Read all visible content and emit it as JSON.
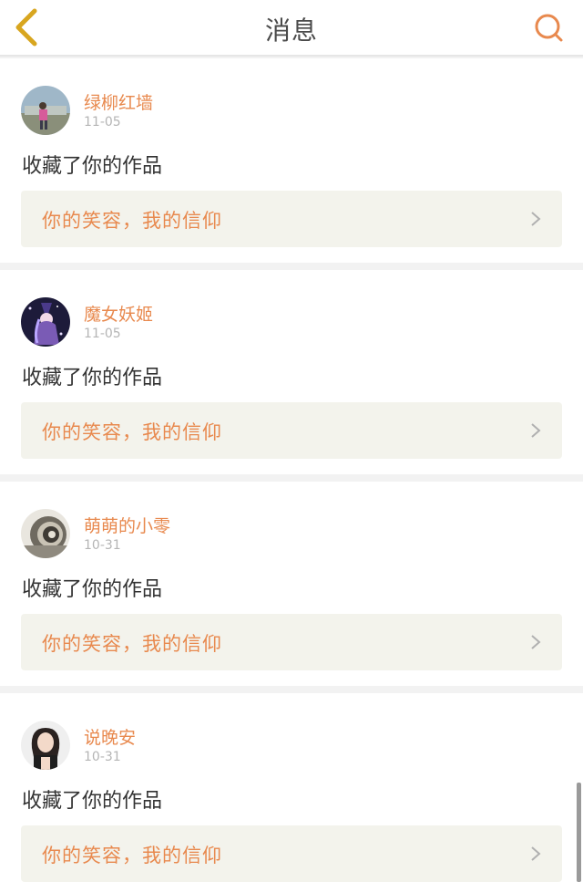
{
  "header": {
    "title": "消息",
    "accent_color": "#e8894e"
  },
  "messages": [
    {
      "user": "绿柳红墙",
      "date": "11-05",
      "action": "收藏了你的作品",
      "work_title": "你的笑容，我的信仰",
      "avatar": "photo-person-outdoors"
    },
    {
      "user": "魔女妖姬",
      "date": "11-05",
      "action": "收藏了你的作品",
      "work_title": "你的笑容，我的信仰",
      "avatar": "anime-witch"
    },
    {
      "user": "萌萌的小零",
      "date": "10-31",
      "action": "收藏了你的作品",
      "work_title": "你的笑容，我的信仰",
      "avatar": "swirl-object"
    },
    {
      "user": "说晚安",
      "date": "10-31",
      "action": "收藏了你的作品",
      "work_title": "你的笑容，我的信仰",
      "avatar": "portrait-woman"
    }
  ]
}
